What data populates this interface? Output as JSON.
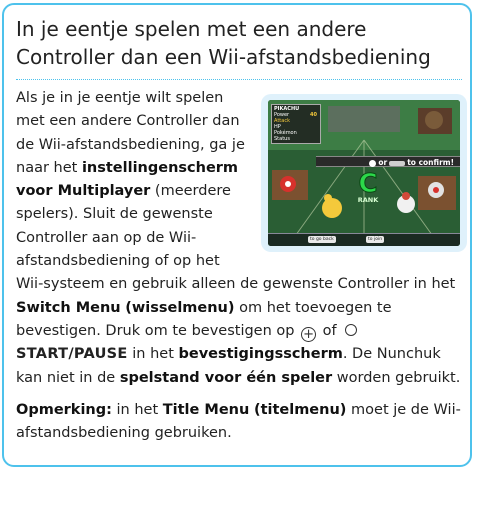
{
  "title": "In je eentje spelen met een andere Controller dan een Wii-afstandsbediening",
  "paragraph1": {
    "t1": "Als je in je eentje wilt spelen met een andere Controller dan de Wii-afstandsbediening, ga je naar het ",
    "b1": "instellingenscherm voor Multiplayer",
    "t2": " (meerdere spelers). Sluit de gewenste Controller aan op de Wii-afstandsbediening of op het Wii-systeem en gebruik alleen de gewenste Controller in het ",
    "b2": "Switch Menu",
    "t3": " ",
    "b3": "(wisselmenu)",
    "t4": " om het toevoegen te bevestigen. Druk om te bevestigen op ",
    "plus_symbol": "+",
    "t5": " of ",
    "start_pause": "START/PAUSE",
    "t6": " in het ",
    "b4": "bevestigingsscherm",
    "t7": ". De Nunchuk kan niet in de ",
    "b5": "spelstand voor één speler",
    "t8": " worden gebruikt."
  },
  "paragraph2": {
    "b1": "Opmerking:",
    "t1": " in het ",
    "b2": "Title Menu",
    "t2": " ",
    "b3": "(titelmenu)",
    "t3": " moet je de Wii-afstandsbediening gebruiken."
  },
  "screenshot": {
    "hud_name": "PIKACHU",
    "hud_lines": [
      "Power",
      "Attack",
      "HP",
      "Pokémon",
      "Status"
    ],
    "hud_level": "40",
    "confirm_or": "or",
    "confirm_text": "to confirm!",
    "rank_letter": "C",
    "rank_word": "RANK",
    "footer_left": "to go back",
    "footer_right": "to join"
  },
  "colors": {
    "border": "#4ec2ec",
    "screenshot_frame": "#dff1fb",
    "rank_green": "#2cd84a"
  }
}
